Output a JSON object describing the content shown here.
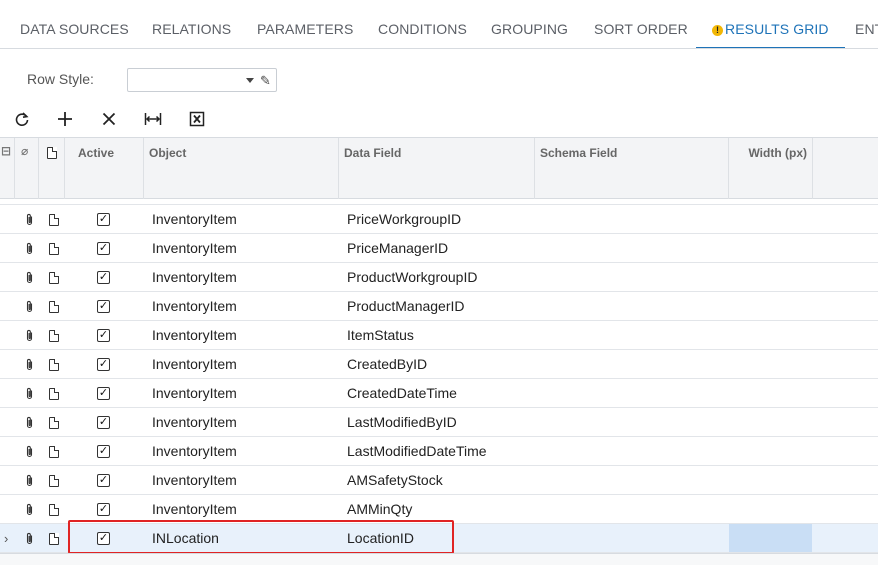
{
  "tabs": [
    {
      "label": "DATA SOURCES",
      "active": false
    },
    {
      "label": "RELATIONS",
      "active": false
    },
    {
      "label": "PARAMETERS",
      "active": false
    },
    {
      "label": "CONDITIONS",
      "active": false
    },
    {
      "label": "GROUPING",
      "active": false
    },
    {
      "label": "SORT ORDER",
      "active": false
    },
    {
      "label": "RESULTS GRID",
      "active": true,
      "icon": "warning-icon"
    },
    {
      "label": "ENT",
      "active": false
    }
  ],
  "row_style": {
    "label": "Row Style:",
    "value": ""
  },
  "toolbar": {
    "buttons": [
      "refresh-icon",
      "add-icon",
      "delete-icon",
      "fit-width-icon",
      "export-excel-icon"
    ]
  },
  "grid": {
    "columns": [
      "Active",
      "Object",
      "Data Field",
      "Schema Field",
      "Width (px)"
    ],
    "rows": [
      {
        "active": true,
        "object": "InventoryItem",
        "field": "PriceWorkgroupID"
      },
      {
        "active": true,
        "object": "InventoryItem",
        "field": "PriceManagerID"
      },
      {
        "active": true,
        "object": "InventoryItem",
        "field": "ProductWorkgroupID"
      },
      {
        "active": true,
        "object": "InventoryItem",
        "field": "ProductManagerID"
      },
      {
        "active": true,
        "object": "InventoryItem",
        "field": "ItemStatus"
      },
      {
        "active": true,
        "object": "InventoryItem",
        "field": "CreatedByID"
      },
      {
        "active": true,
        "object": "InventoryItem",
        "field": "CreatedDateTime"
      },
      {
        "active": true,
        "object": "InventoryItem",
        "field": "LastModifiedByID"
      },
      {
        "active": true,
        "object": "InventoryItem",
        "field": "LastModifiedDateTime"
      },
      {
        "active": true,
        "object": "InventoryItem",
        "field": "AMSafetyStock"
      },
      {
        "active": true,
        "object": "InventoryItem",
        "field": "AMMinQty"
      },
      {
        "active": true,
        "object": "INLocation",
        "field": "LocationID",
        "selected": true
      }
    ]
  },
  "colors": {
    "accent": "#1e73b8",
    "highlight": "#e02424",
    "selected_row": "#e8f1fb",
    "warning": "#f2b705"
  }
}
